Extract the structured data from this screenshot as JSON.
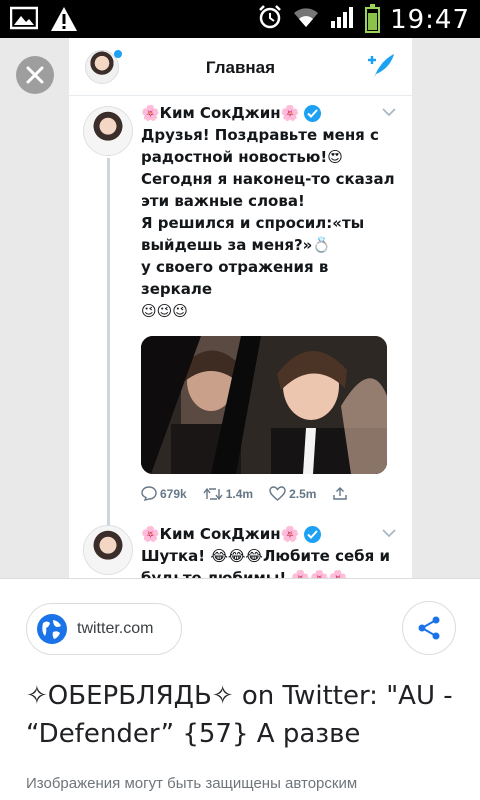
{
  "statusbar": {
    "time": "19:47",
    "icons": [
      "image-icon",
      "warning-icon",
      "alarm-icon",
      "wifi-icon",
      "signal-icon",
      "battery-icon"
    ]
  },
  "viewer": {
    "close_icon": "close-icon"
  },
  "tweet_screenshot": {
    "header_title": "Главная",
    "compose_icon": "compose-feather-icon",
    "tweet1": {
      "name": "🌸Ким СокДжин🌸",
      "text": "Друзья! Поздравьте меня с\nрадостной новостью!😍\nСегодня я наконец-то сказал\nэти важные слова!\nЯ решился и спросил:«ты\nвыйдешь за меня?»💍\nу своего отражения в зеркале\n😉😉😉",
      "replies": "679k",
      "retweets": "1.4m",
      "likes": "2.5m"
    },
    "tweet2": {
      "name": "🌸Ким СокДжин🌸",
      "text": "Шутка! 😂😂😂Любите себя и\nбудьте любимы! 🌸🌸🌸"
    }
  },
  "card": {
    "source": "twitter.com",
    "title": "✧ОБЕРБЛЯДЬ✧ on Twitter: \"AU - “Defender” {57} А разве",
    "disclaimer": "Изображения могут быть защищены авторским"
  },
  "colors": {
    "twitter_blue": "#1da1f2",
    "google_blue": "#1a73e8"
  }
}
